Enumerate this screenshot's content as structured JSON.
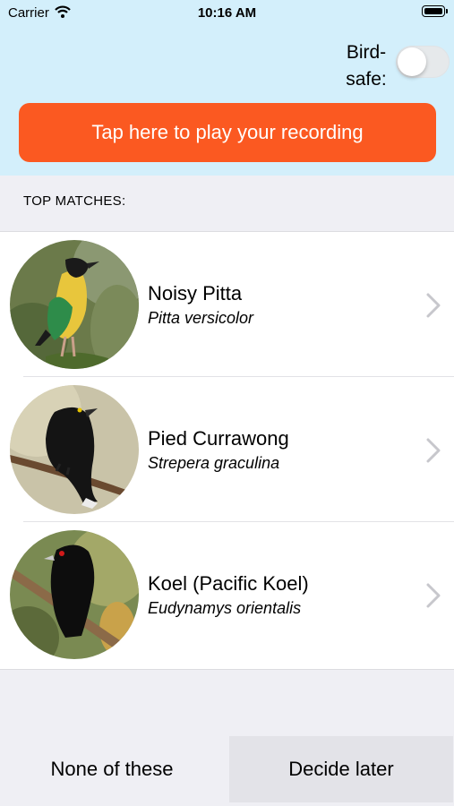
{
  "status_bar": {
    "carrier": "Carrier",
    "time": "10:16 AM"
  },
  "bird_safe": {
    "label_line1": "Bird-",
    "label_line2": "safe:",
    "enabled": false
  },
  "play_button": {
    "label": "Tap here to play your recording",
    "color": "#fb5921"
  },
  "section_header": "TOP MATCHES:",
  "matches": [
    {
      "common_name": "Noisy Pitta",
      "scientific_name": "Pitta versicolor",
      "icon": "noisy-pitta-photo"
    },
    {
      "common_name": "Pied Currawong",
      "scientific_name": "Strepera graculina",
      "icon": "pied-currawong-photo"
    },
    {
      "common_name": "Koel (Pacific Koel)",
      "scientific_name": "Eudynamys orientalis",
      "icon": "koel-photo"
    }
  ],
  "bottom_buttons": {
    "none": "None of these",
    "later": "Decide later"
  },
  "colors": {
    "header_bg": "#d3effb",
    "page_bg": "#efeff4"
  }
}
